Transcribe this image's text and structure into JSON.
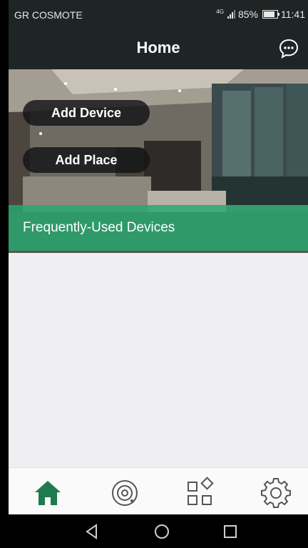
{
  "status_bar": {
    "carrier": "GR COSMOTE",
    "network": "4G",
    "battery": "85%",
    "battery_level": 0.85,
    "time": "11:41"
  },
  "header": {
    "title": "Home",
    "chat_icon": "chat-bubble-icon"
  },
  "hero": {
    "add_device_label": "Add Device",
    "add_place_label": "Add Place",
    "section_title": "Frequently-Used Devices"
  },
  "bottom_nav": {
    "items": [
      {
        "icon": "home-icon",
        "active": true
      },
      {
        "icon": "camera-icon",
        "active": false
      },
      {
        "icon": "apps-icon",
        "active": false
      },
      {
        "icon": "settings-icon",
        "active": false
      }
    ]
  },
  "system_nav": {
    "buttons": [
      "back-icon",
      "home-circle-icon",
      "recents-icon"
    ]
  },
  "colors": {
    "accent": "#1f7a4d",
    "section_band": "#26a870",
    "header_bg": "#1f2425",
    "content_bg": "#efeff2"
  }
}
